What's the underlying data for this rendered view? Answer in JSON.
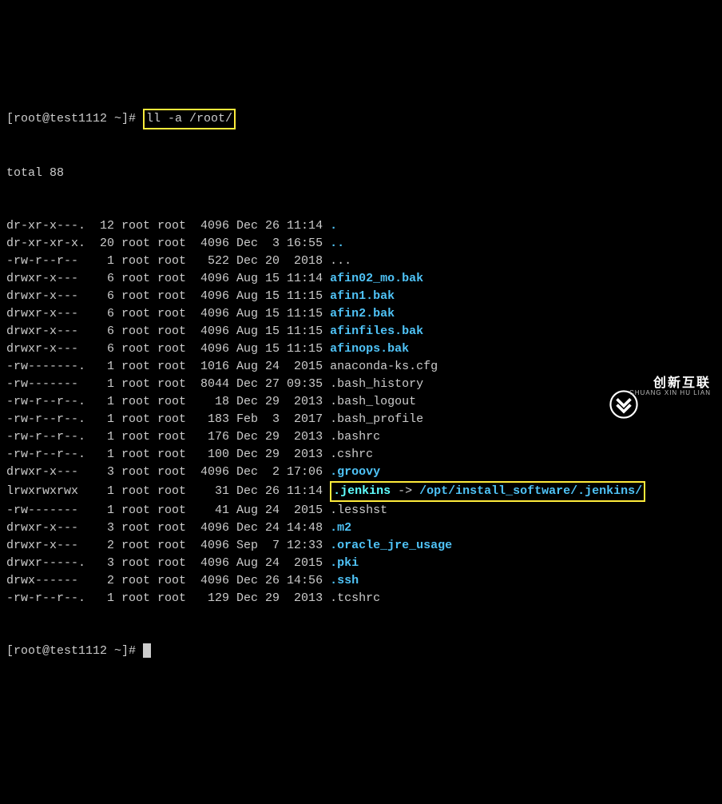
{
  "prompt_prefix": "[root@test1112 ~]# ",
  "command": "ll -a /root/",
  "total_line": "total 88",
  "rows": [
    {
      "perm": "dr-xr-x---.",
      "links": "12",
      "owner": "root",
      "group": "root",
      "size": "4096",
      "date": "Dec 26 11:14",
      "name": ".",
      "cls": "dir-color"
    },
    {
      "perm": "dr-xr-xr-x.",
      "links": "20",
      "owner": "root",
      "group": "root",
      "size": "4096",
      "date": "Dec  3 16:55",
      "name": "..",
      "cls": "dir-color"
    },
    {
      "perm": "-rw-r--r--",
      "links": "1",
      "owner": "root",
      "group": "root",
      "size": "522",
      "date": "Dec 20  2018",
      "name": "...",
      "cls": ""
    },
    {
      "perm": "drwxr-x---",
      "links": "6",
      "owner": "root",
      "group": "root",
      "size": "4096",
      "date": "Aug 15 11:14",
      "name": "afin02_mo.bak",
      "cls": "dir-color"
    },
    {
      "perm": "drwxr-x---",
      "links": "6",
      "owner": "root",
      "group": "root",
      "size": "4096",
      "date": "Aug 15 11:15",
      "name": "afin1.bak",
      "cls": "dir-color"
    },
    {
      "perm": "drwxr-x---",
      "links": "6",
      "owner": "root",
      "group": "root",
      "size": "4096",
      "date": "Aug 15 11:15",
      "name": "afin2.bak",
      "cls": "dir-color"
    },
    {
      "perm": "drwxr-x---",
      "links": "6",
      "owner": "root",
      "group": "root",
      "size": "4096",
      "date": "Aug 15 11:15",
      "name": "afinfiles.bak",
      "cls": "dir-color"
    },
    {
      "perm": "drwxr-x---",
      "links": "6",
      "owner": "root",
      "group": "root",
      "size": "4096",
      "date": "Aug 15 11:15",
      "name": "afinops.bak",
      "cls": "dir-color"
    },
    {
      "perm": "-rw-------.",
      "links": "1",
      "owner": "root",
      "group": "root",
      "size": "1016",
      "date": "Aug 24  2015",
      "name": "anaconda-ks.cfg",
      "cls": ""
    },
    {
      "perm": "-rw-------",
      "links": "1",
      "owner": "root",
      "group": "root",
      "size": "8044",
      "date": "Dec 27 09:35",
      "name": ".bash_history",
      "cls": ""
    },
    {
      "perm": "-rw-r--r--.",
      "links": "1",
      "owner": "root",
      "group": "root",
      "size": "18",
      "date": "Dec 29  2013",
      "name": ".bash_logout",
      "cls": ""
    },
    {
      "perm": "-rw-r--r--.",
      "links": "1",
      "owner": "root",
      "group": "root",
      "size": "183",
      "date": "Feb  3  2017",
      "name": ".bash_profile",
      "cls": ""
    },
    {
      "perm": "-rw-r--r--.",
      "links": "1",
      "owner": "root",
      "group": "root",
      "size": "176",
      "date": "Dec 29  2013",
      "name": ".bashrc",
      "cls": ""
    },
    {
      "perm": "-rw-r--r--.",
      "links": "1",
      "owner": "root",
      "group": "root",
      "size": "100",
      "date": "Dec 29  2013",
      "name": ".cshrc",
      "cls": ""
    },
    {
      "perm": "drwxr-x---",
      "links": "3",
      "owner": "root",
      "group": "root",
      "size": "4096",
      "date": "Dec  2 17:06",
      "name": ".groovy",
      "cls": "dir-color"
    },
    {
      "perm": "lrwxrwxrwx",
      "links": "1",
      "owner": "root",
      "group": "root",
      "size": "31",
      "date": "Dec 26 11:14",
      "name": ".jenkins",
      "target": "/opt/install_software/.jenkins/",
      "cls": "link-color",
      "highlight": true
    },
    {
      "perm": "-rw-------",
      "links": "1",
      "owner": "root",
      "group": "root",
      "size": "41",
      "date": "Aug 24  2015",
      "name": ".lesshst",
      "cls": ""
    },
    {
      "perm": "drwxr-x---",
      "links": "3",
      "owner": "root",
      "group": "root",
      "size": "4096",
      "date": "Dec 24 14:48",
      "name": ".m2",
      "cls": "dir-color"
    },
    {
      "perm": "drwxr-x---",
      "links": "2",
      "owner": "root",
      "group": "root",
      "size": "4096",
      "date": "Sep  7 12:33",
      "name": ".oracle_jre_usage",
      "cls": "dir-color"
    },
    {
      "perm": "drwxr-----.",
      "links": "3",
      "owner": "root",
      "group": "root",
      "size": "4096",
      "date": "Aug 24  2015",
      "name": ".pki",
      "cls": "dir-color"
    },
    {
      "perm": "drwx------",
      "links": "2",
      "owner": "root",
      "group": "root",
      "size": "4096",
      "date": "Dec 26 14:56",
      "name": ".ssh",
      "cls": "dir-color"
    },
    {
      "perm": "-rw-r--r--.",
      "links": "1",
      "owner": "root",
      "group": "root",
      "size": "129",
      "date": "Dec 29  2013",
      "name": ".tcshrc",
      "cls": ""
    }
  ],
  "second_prompt": "[root@test1112 ~]# ",
  "watermark": {
    "cn": "创新互联",
    "py": "CHUANG XIN HU LIAN"
  }
}
